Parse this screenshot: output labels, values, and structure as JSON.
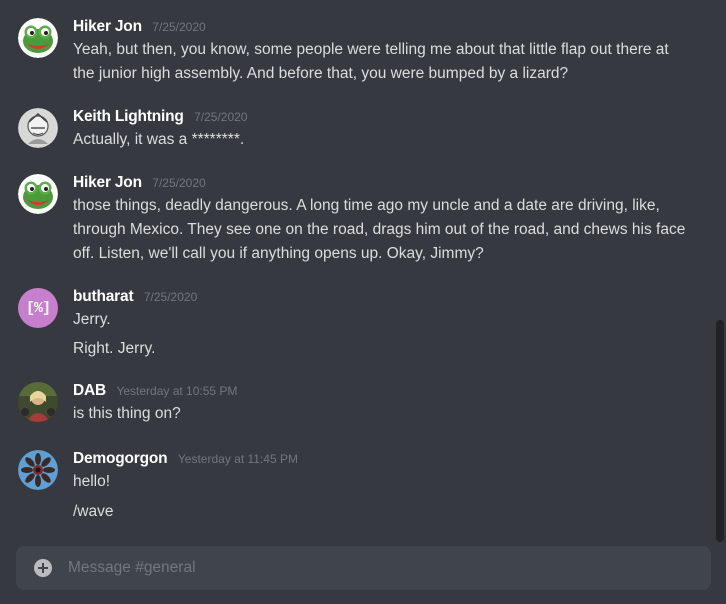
{
  "messages": [
    {
      "author": "Hiker Jon",
      "timestamp": "7/25/2020",
      "avatar_icon": "pepe-frog-avatar",
      "lines": [
        "Yeah, but then, you know, some people were telling me about that little flap out there at",
        "the junior high assembly. And before that, you were bumped by a lizard?"
      ]
    },
    {
      "author": "Keith Lightning",
      "timestamp": "7/25/2020",
      "avatar_icon": "grayscale-portrait-avatar",
      "lines": [
        "Actually, it was a ********."
      ]
    },
    {
      "author": "Hiker Jon",
      "timestamp": "7/25/2020",
      "avatar_icon": "pepe-frog-avatar",
      "lines": [
        "those things, deadly dangerous. A long time ago my uncle and a date are driving, like,",
        "through Mexico. They see one on the road, drags him out of the road, and chews his face",
        "off. Listen, we'll call you if anything opens up. Okay, Jimmy?"
      ]
    },
    {
      "author": "butharat",
      "timestamp": "7/25/2020",
      "avatar_icon": "percent-bracket-avatar",
      "avatar_text": "[%]",
      "lines": [
        "Jerry.",
        "Right. Jerry."
      ]
    },
    {
      "author": "DAB",
      "timestamp": "Yesterday at 10:55 PM",
      "avatar_icon": "photo-avatar",
      "lines": [
        "is this thing on?"
      ]
    },
    {
      "author": "Demogorgon",
      "timestamp": "Yesterday at 11:45 PM",
      "avatar_icon": "demogorgon-avatar",
      "lines": [
        "hello!",
        "/wave"
      ]
    }
  ],
  "composer": {
    "placeholder": "Message #general",
    "add_icon": "plus-circle-icon"
  },
  "colors": {
    "background": "#36393f",
    "composer_bg": "#40444b",
    "author": "#ffffff",
    "timestamp": "#72767d",
    "text": "#dcddde"
  }
}
